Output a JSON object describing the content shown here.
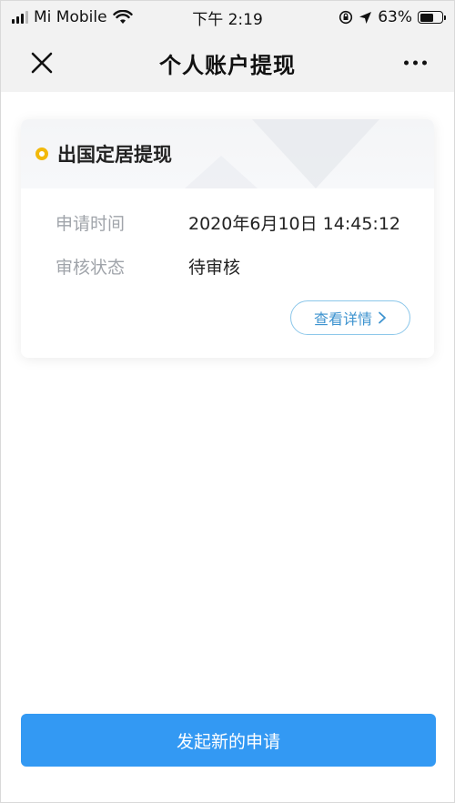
{
  "status_bar": {
    "carrier": "Mi Mobile",
    "time": "下午 2:19",
    "battery": "63%",
    "battery_level": 0.63,
    "icons": [
      "signal-icon",
      "wifi-icon",
      "rotation-lock-icon",
      "location-arrow-icon",
      "battery-icon"
    ]
  },
  "nav": {
    "title": "个人账户提现",
    "left_icon": "close-icon",
    "right_icon": "more-icon"
  },
  "card": {
    "title": "出国定居提现",
    "rows": [
      {
        "label": "申请时间",
        "value": "2020年6月10日 14:45:12"
      },
      {
        "label": "审核状态",
        "value": "待审核"
      }
    ],
    "detail_button": "查看详情"
  },
  "footer": {
    "primary_button": "发起新的申请"
  },
  "colors": {
    "accent": "#3399f3",
    "marker": "#f2b90b",
    "link": "#3d93cf"
  }
}
